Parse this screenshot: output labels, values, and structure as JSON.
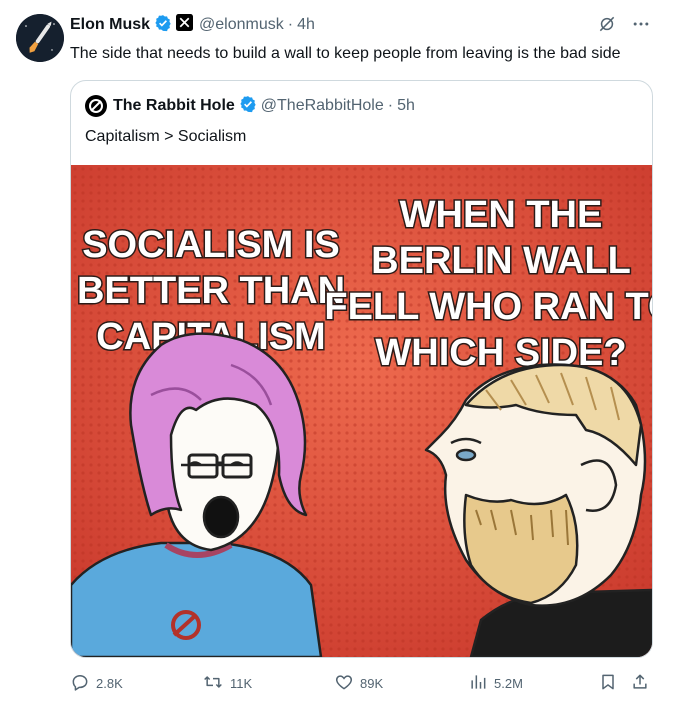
{
  "tweet": {
    "author_name": "Elon Musk",
    "handle": "@elonmusk",
    "separator": "·",
    "time": "4h",
    "text": "The side that needs to build a wall to keep people from leaving is the bad side"
  },
  "quote": {
    "author_name": "The Rabbit Hole",
    "handle": "@TheRabbitHole",
    "separator": "·",
    "time": "5h",
    "text": "Capitalism > Socialism",
    "meme": {
      "left_caption_lines": [
        "SOCIALISM IS",
        "BETTER THAN",
        "CAPITALISM"
      ],
      "right_caption_lines": [
        "WHEN THE",
        "BERLIN WALL",
        "FELL WHO RAN TO",
        "WHICH SIDE?"
      ]
    }
  },
  "actions": {
    "replies": "2.8K",
    "reposts": "11K",
    "likes": "89K",
    "views": "5.2M"
  },
  "colors": {
    "accent_blue": "#1d9bf0",
    "secondary_text": "#536471",
    "meme_background": "#e0523d"
  },
  "icons": [
    "verified-badge-icon",
    "x-affiliate-icon",
    "grok-icon",
    "more-icon",
    "reply-icon",
    "repost-icon",
    "like-icon",
    "views-icon",
    "bookmark-icon",
    "share-icon"
  ]
}
